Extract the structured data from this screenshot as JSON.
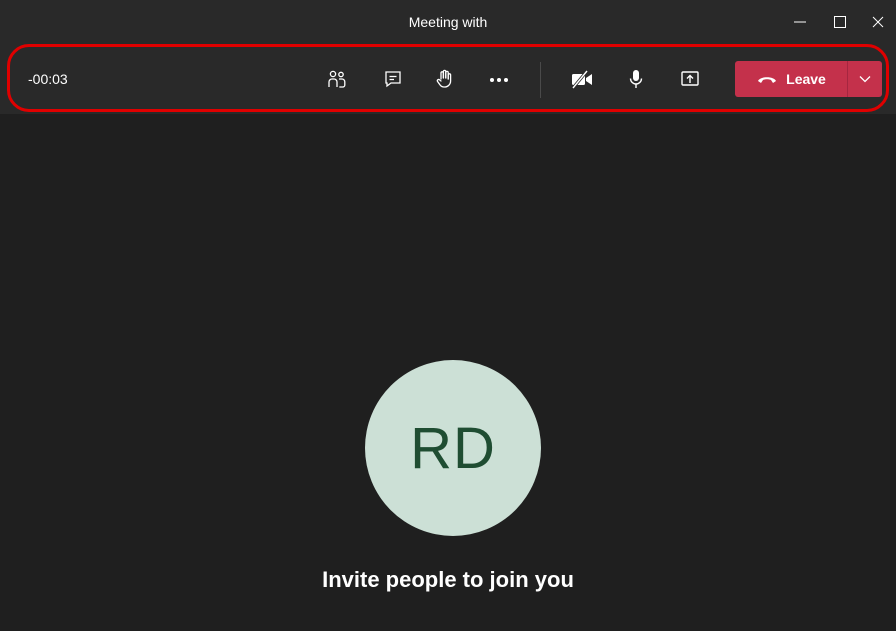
{
  "window": {
    "title": "Meeting with"
  },
  "toolbar": {
    "timer": "-00:03",
    "buttons": [
      {
        "name": "participants",
        "icon": "people-icon"
      },
      {
        "name": "chat",
        "icon": "chat-icon"
      },
      {
        "name": "raise-hand",
        "icon": "hand-icon"
      },
      {
        "name": "more-actions",
        "icon": "ellipsis-icon"
      },
      {
        "name": "camera",
        "icon": "camera-off-icon"
      },
      {
        "name": "mic",
        "icon": "microphone-icon"
      },
      {
        "name": "share",
        "icon": "share-tray-icon"
      }
    ],
    "leave_label": "Leave"
  },
  "stage": {
    "avatar_initials": "RD",
    "invite_text": "Invite people to join you"
  },
  "colors": {
    "background": "#1f1f1f",
    "bar": "#292929",
    "leave": "#c4314b",
    "highlight": "#e00000",
    "avatar_bg": "#cce0d6",
    "avatar_text": "#1f4d32"
  }
}
